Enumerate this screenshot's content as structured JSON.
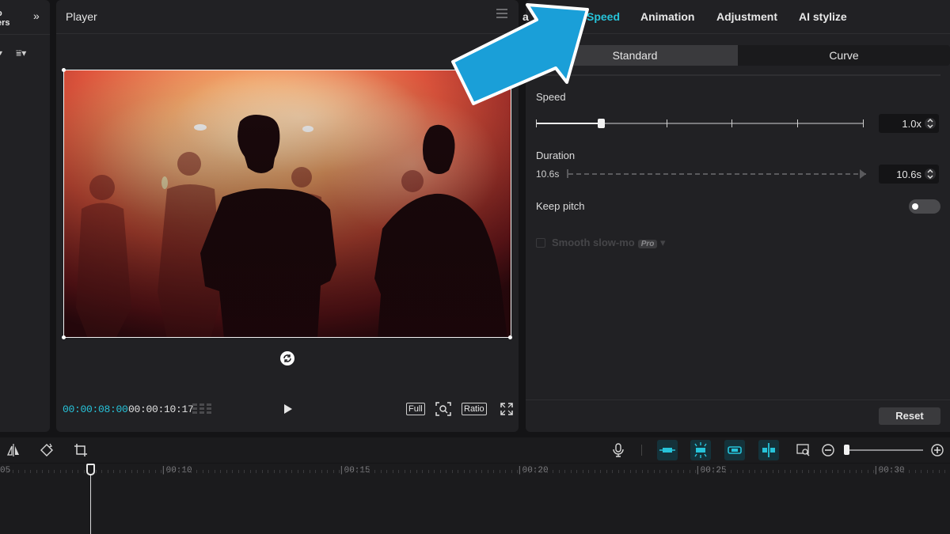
{
  "left_panel": {
    "label_line1": "o",
    "label_line2": "ers",
    "expand_icon": "double-chevron-right",
    "filter_icon": "filter-sort"
  },
  "player": {
    "title": "Player",
    "current_time": "00:00:08:00",
    "total_time": "00:00:10:17",
    "buttons": {
      "full": "Full",
      "ratio": "Ratio"
    }
  },
  "inspector": {
    "tabs": [
      {
        "label": "Speed",
        "active": true
      },
      {
        "label": "Animation"
      },
      {
        "label": "Adjustment"
      },
      {
        "label": "AI stylize"
      }
    ],
    "modes": {
      "standard": "Standard",
      "curve": "Curve"
    },
    "speed": {
      "label": "Speed",
      "value": "1.0x",
      "level": 0.2
    },
    "duration": {
      "label": "Duration",
      "original": "10.6s",
      "value": "10.6s"
    },
    "keep_pitch": {
      "label": "Keep pitch",
      "on": false
    },
    "smooth_slow_mo": {
      "label": "Smooth slow-mo",
      "badge": "Pro",
      "enabled": false
    },
    "reset_label": "Reset"
  },
  "timeline": {
    "ruler": [
      "05",
      "|00:10",
      "|00:15",
      "|00:20",
      "|00:25",
      "|00:30"
    ]
  },
  "colors": {
    "accent": "#27c3d9",
    "callout": "#1a9fd8"
  }
}
